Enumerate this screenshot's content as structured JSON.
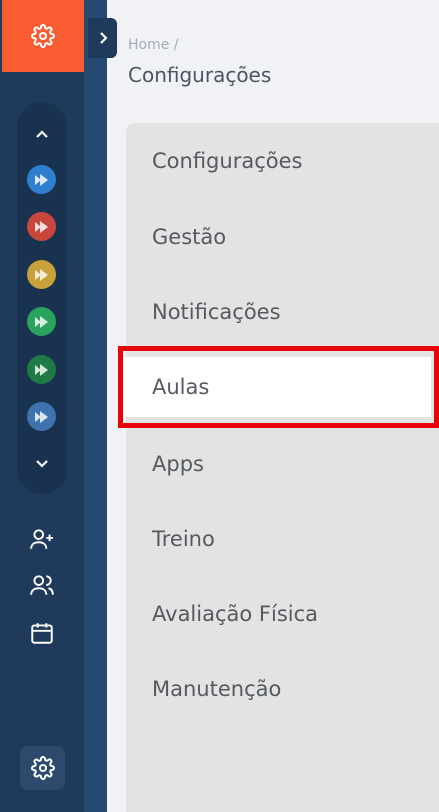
{
  "header": {
    "breadcrumb": "Home /",
    "title": "Configurações"
  },
  "menu": {
    "items": [
      {
        "label": "Configurações",
        "active": false
      },
      {
        "label": "Gestão",
        "active": false
      },
      {
        "label": "Notificações",
        "active": false
      },
      {
        "label": "Aulas",
        "active": true
      },
      {
        "label": "Apps",
        "active": false
      },
      {
        "label": "Treino",
        "active": false
      },
      {
        "label": "Avaliação Física",
        "active": false
      },
      {
        "label": "Manutenção",
        "active": false
      }
    ]
  },
  "sidebar": {
    "top_icon": "gear-icon",
    "expand_icon": "chevron-right-icon",
    "modules": [
      {
        "icon": "module-icon",
        "color": "#2f7fd0"
      },
      {
        "icon": "module-icon",
        "color": "#c9463d"
      },
      {
        "icon": "module-icon",
        "color": "#c9a13a"
      },
      {
        "icon": "module-icon",
        "color": "#2aa35f"
      },
      {
        "icon": "module-icon",
        "color": "#1f7a45"
      },
      {
        "icon": "module-icon",
        "color": "#3f73b0"
      }
    ],
    "nav_icons": [
      "add-user-icon",
      "users-icon",
      "calendar-icon"
    ],
    "bottom_icon": "gear-icon"
  },
  "colors": {
    "accent": "#fa5c32",
    "rail": "#1f3a5a",
    "highlight": "#e8000a"
  }
}
